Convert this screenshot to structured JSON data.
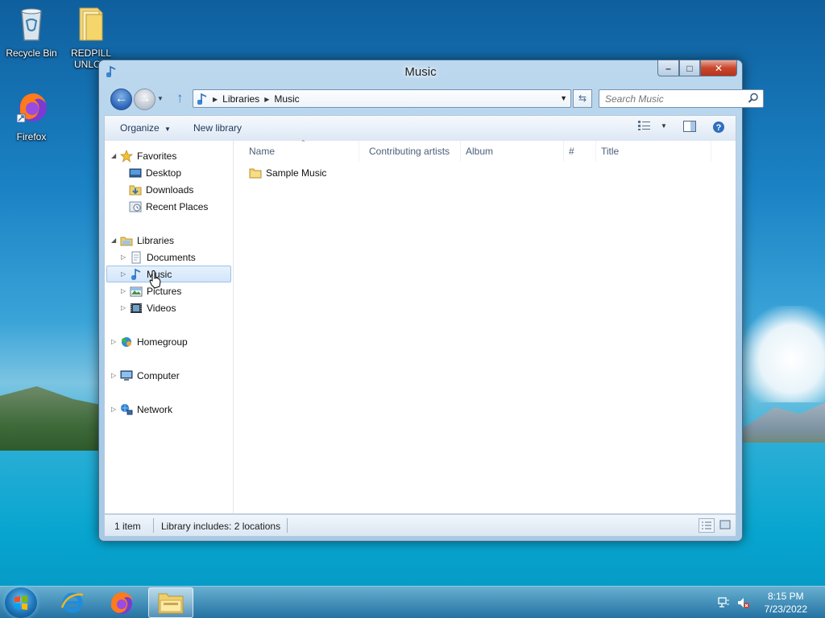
{
  "desktop": {
    "icons": [
      {
        "label": "Recycle Bin",
        "icon": "recycle-bin-icon"
      },
      {
        "label": "REDPILL UNLOC",
        "icon": "folder-icon"
      },
      {
        "label": "Firefox",
        "icon": "firefox-icon"
      }
    ]
  },
  "window": {
    "title": "Music",
    "icon": "music-library-icon",
    "breadcrumb": [
      "Libraries",
      "Music"
    ],
    "search_placeholder": "Search Music",
    "toolbar": {
      "organize": "Organize",
      "new_library": "New library"
    },
    "nav": {
      "favorites": {
        "label": "Favorites",
        "items": [
          "Desktop",
          "Downloads",
          "Recent Places"
        ]
      },
      "libraries": {
        "label": "Libraries",
        "items": [
          "Documents",
          "Music",
          "Pictures",
          "Videos"
        ],
        "selected": "Music"
      },
      "homegroup": "Homegroup",
      "computer": "Computer",
      "network": "Network"
    },
    "columns": [
      "Name",
      "Contributing artists",
      "Album",
      "#",
      "Title"
    ],
    "files": [
      {
        "name": "Sample Music",
        "type": "folder"
      }
    ],
    "status": {
      "items": "1 item",
      "library_info": "Library includes: 2 locations"
    }
  },
  "taskbar": {
    "apps": [
      "start-orb",
      "internet-explorer-icon",
      "firefox-icon",
      "windows-explorer-icon"
    ],
    "clock_time": "8:15 PM",
    "clock_date": "7/23/2022"
  }
}
